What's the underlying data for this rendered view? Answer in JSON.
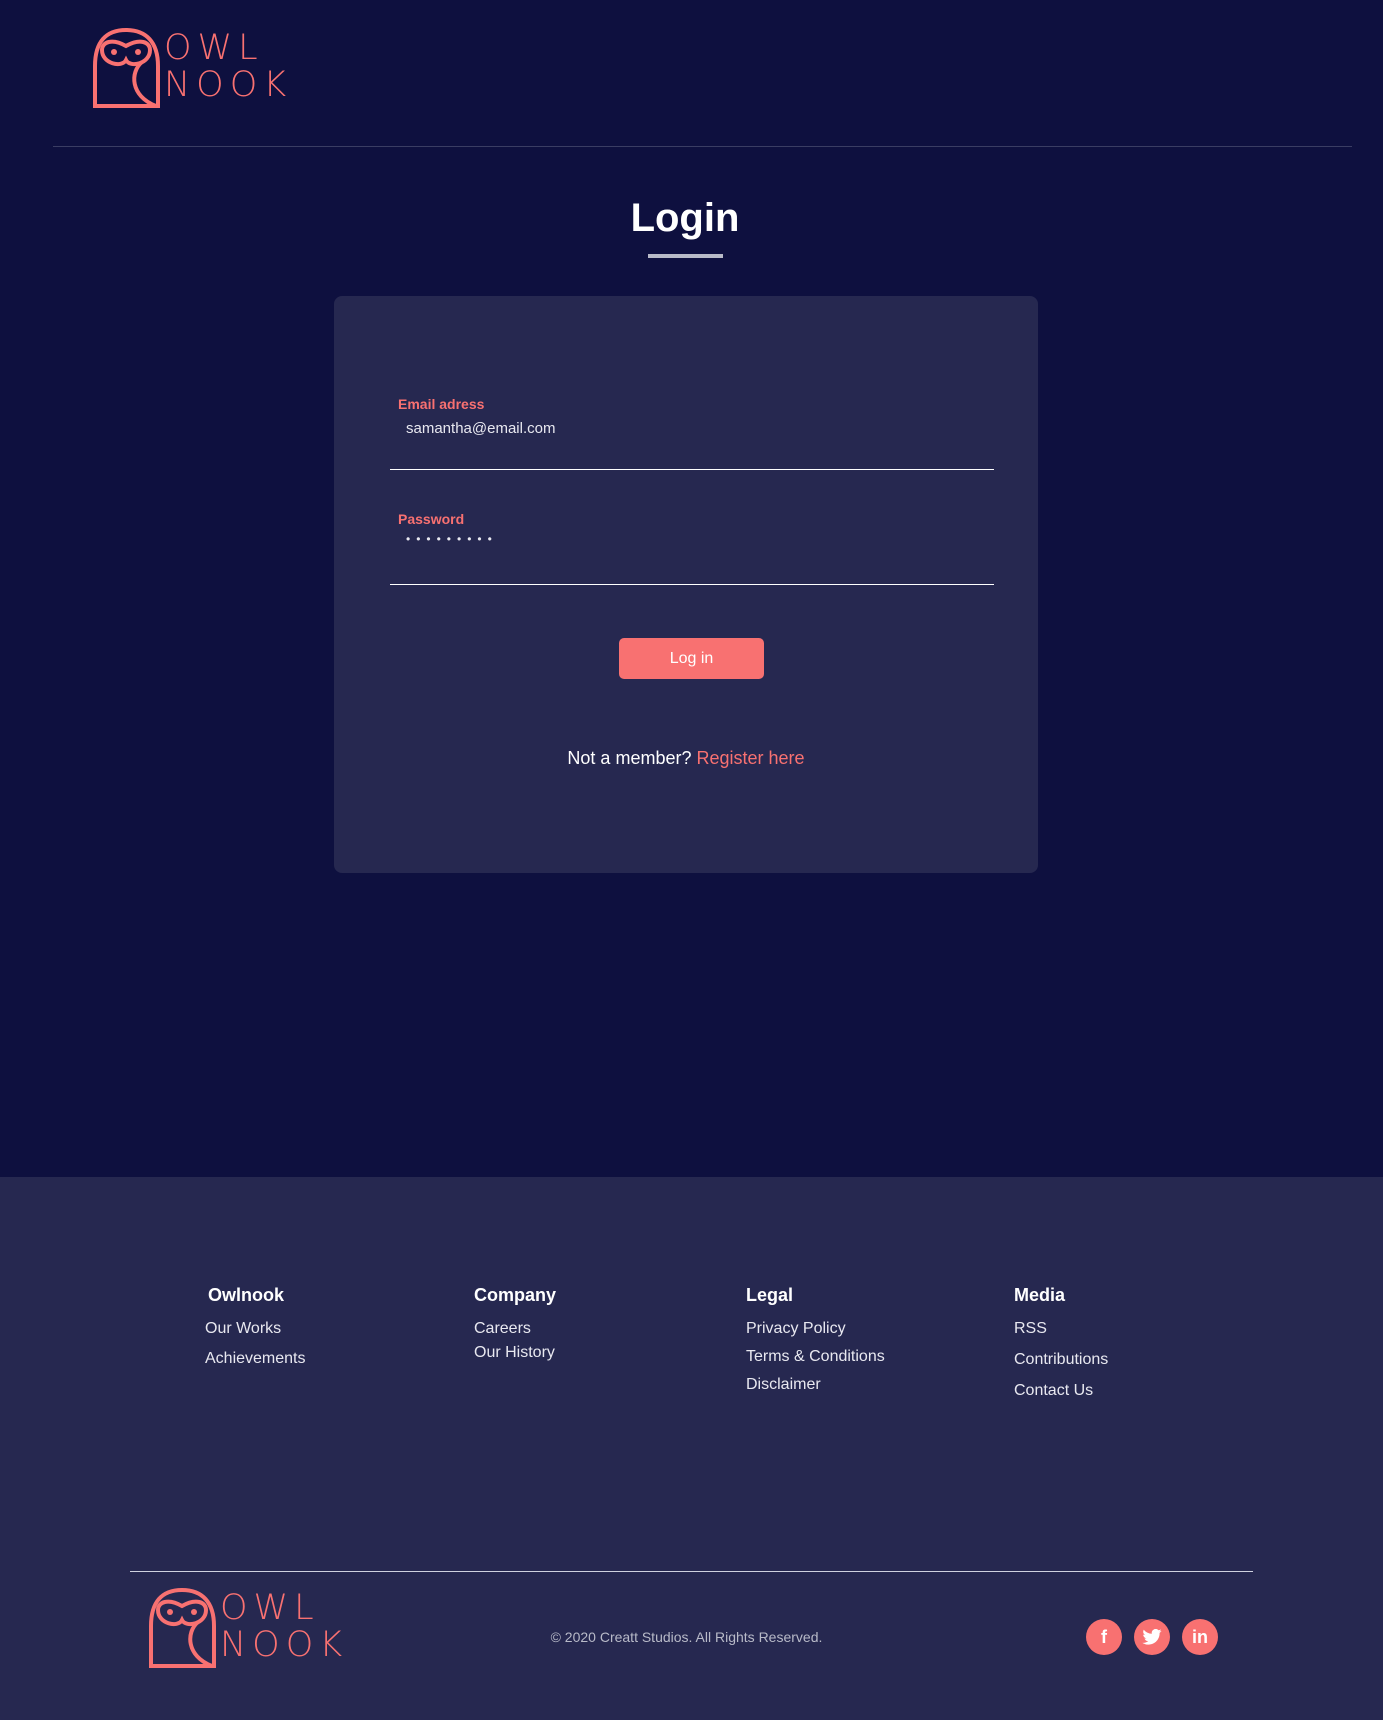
{
  "header": {
    "logo_line1": "OWL",
    "logo_line2": "NOOK"
  },
  "login": {
    "title": "Login",
    "email_label": "Email adress",
    "email_value": "samantha@email.com",
    "password_label": "Password",
    "password_value": "•••••••••",
    "button": "Log in",
    "not_member": "Not a member?",
    "register_link": "Register here"
  },
  "footer": {
    "columns": [
      {
        "heading": "Owlnook",
        "links": [
          "Our Works",
          "Achievements"
        ]
      },
      {
        "heading": "Company",
        "links": [
          "Careers",
          "Our History"
        ]
      },
      {
        "heading": "Legal",
        "links": [
          "Privacy Policy",
          "Terms & Conditions",
          "Disclaimer"
        ]
      },
      {
        "heading": "Media",
        "links": [
          "RSS",
          "Contributions",
          "Contact Us"
        ]
      }
    ],
    "copyright": "© 2020 Creatt Studios. All Rights Reserved.",
    "social": {
      "facebook": "f",
      "twitter": "twitter-icon",
      "linkedin": "in"
    }
  },
  "colors": {
    "accent": "#f87171",
    "bg": "#0e103f",
    "card": "#262850"
  }
}
